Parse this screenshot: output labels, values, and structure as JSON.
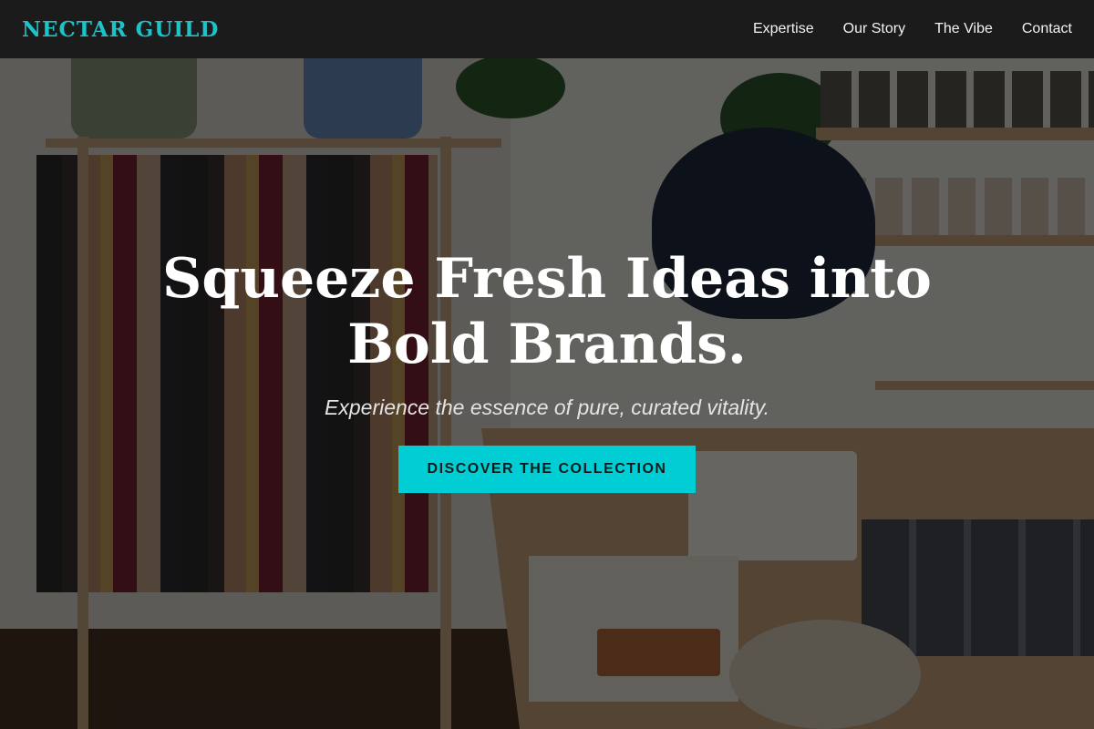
{
  "nav": {
    "brand": "NECTAR GUILD",
    "links": [
      "Expertise",
      "Our Story",
      "The Vibe",
      "Contact"
    ]
  },
  "hero": {
    "title": "Squeeze Fresh Ideas into Bold Brands.",
    "subtitle": "Experience the essence of pure, curated vitality.",
    "cta": "DISCOVER THE COLLECTION"
  },
  "colors": {
    "brand": "#1cc3c9",
    "cta_background": "#00ced4",
    "nav_background": "#1b1b1b"
  }
}
